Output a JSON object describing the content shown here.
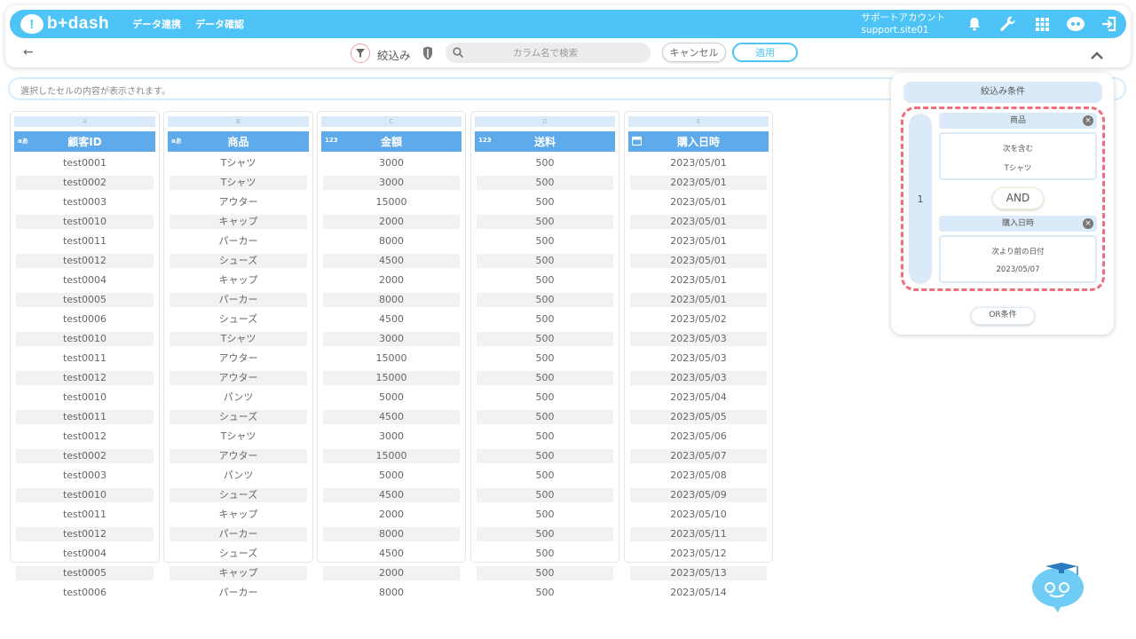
{
  "app": {
    "brand": "b+dash",
    "brand_mark": "!"
  },
  "nav": {
    "links": [
      "データ連携",
      "データ確認"
    ]
  },
  "account": {
    "line1": "サポートアカウント",
    "line2": "support.site01"
  },
  "header_icons": [
    "bell-icon",
    "wrench-icon",
    "grid-icon",
    "brain-icon",
    "logout-icon"
  ],
  "toolbar": {
    "back": "←",
    "filter_label": "絞込み",
    "search_placeholder": "カラム名で検索",
    "cancel_label": "キャンセル",
    "apply_label": "適用"
  },
  "cellbar": {
    "placeholder": "選択したセルの内容が表示されます。"
  },
  "table": {
    "columns": [
      {
        "letter": "A",
        "type": "aあ",
        "name": "顧客ID"
      },
      {
        "letter": "B",
        "type": "aあ",
        "name": "商品"
      },
      {
        "letter": "C",
        "type": "123",
        "name": "金額"
      },
      {
        "letter": "D",
        "type": "123",
        "name": "送料"
      },
      {
        "letter": "E",
        "type": "cal",
        "name": "購入日時"
      }
    ],
    "rows": [
      [
        "test0001",
        "Tシャツ",
        "3000",
        "500",
        "2023/05/01"
      ],
      [
        "test0002",
        "Tシャツ",
        "3000",
        "500",
        "2023/05/01"
      ],
      [
        "test0003",
        "アウター",
        "15000",
        "500",
        "2023/05/01"
      ],
      [
        "test0010",
        "キャップ",
        "2000",
        "500",
        "2023/05/01"
      ],
      [
        "test0011",
        "パーカー",
        "8000",
        "500",
        "2023/05/01"
      ],
      [
        "test0012",
        "シューズ",
        "4500",
        "500",
        "2023/05/01"
      ],
      [
        "test0004",
        "キャップ",
        "2000",
        "500",
        "2023/05/01"
      ],
      [
        "test0005",
        "パーカー",
        "8000",
        "500",
        "2023/05/01"
      ],
      [
        "test0006",
        "シューズ",
        "4500",
        "500",
        "2023/05/02"
      ],
      [
        "test0010",
        "Tシャツ",
        "3000",
        "500",
        "2023/05/03"
      ],
      [
        "test0011",
        "アウター",
        "15000",
        "500",
        "2023/05/03"
      ],
      [
        "test0012",
        "アウター",
        "15000",
        "500",
        "2023/05/03"
      ],
      [
        "test0010",
        "パンツ",
        "5000",
        "500",
        "2023/05/04"
      ],
      [
        "test0011",
        "シューズ",
        "4500",
        "500",
        "2023/05/05"
      ],
      [
        "test0012",
        "Tシャツ",
        "3000",
        "500",
        "2023/05/06"
      ],
      [
        "test0002",
        "アウター",
        "15000",
        "500",
        "2023/05/07"
      ],
      [
        "test0003",
        "パンツ",
        "5000",
        "500",
        "2023/05/08"
      ],
      [
        "test0010",
        "シューズ",
        "4500",
        "500",
        "2023/05/09"
      ],
      [
        "test0011",
        "キャップ",
        "2000",
        "500",
        "2023/05/10"
      ],
      [
        "test0012",
        "パーカー",
        "8000",
        "500",
        "2023/05/11"
      ],
      [
        "test0004",
        "シューズ",
        "4500",
        "500",
        "2023/05/12"
      ],
      [
        "test0005",
        "キャップ",
        "2000",
        "500",
        "2023/05/13"
      ],
      [
        "test0006",
        "パーカー",
        "8000",
        "500",
        "2023/05/14"
      ]
    ]
  },
  "filter_panel": {
    "title": "絞込み条件",
    "group_number": "1",
    "conditions": [
      {
        "column": "商品",
        "operator": "次を含む",
        "value": "Tシャツ"
      },
      {
        "column": "購入日時",
        "operator": "次より前の日付",
        "value": "2023/05/07"
      }
    ],
    "and_label": "AND",
    "or_label": "OR条件"
  },
  "colors": {
    "primary": "#4ec3f5",
    "header_blue": "#5eaaea",
    "light_blue": "#dbeaf8",
    "highlight": "#ef6d7d"
  }
}
